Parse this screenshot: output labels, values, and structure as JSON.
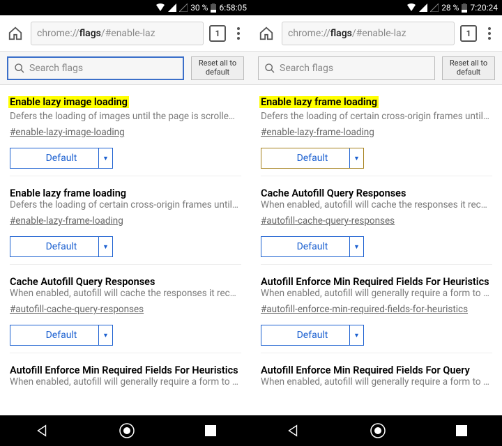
{
  "left": {
    "status": {
      "battery_pct": "30 %",
      "time": "6:58:05"
    },
    "omnibox": {
      "prefix": "chrome://",
      "bold": "flags",
      "suffix": "/#enable-laz"
    },
    "tab_count": "1",
    "search_placeholder": "Search flags",
    "reset_label": "Reset all to default",
    "flags": [
      {
        "title": "Enable lazy image loading",
        "desc": "Defers the loading of images until the page is scrolle…",
        "anchor": "#enable-lazy-image-loading",
        "select": "Default",
        "highlight": true,
        "gold": false
      },
      {
        "title": "Enable lazy frame loading",
        "desc": "Defers the loading of certain cross-origin frames until…",
        "anchor": "#enable-lazy-frame-loading",
        "select": "Default",
        "highlight": false,
        "gold": false
      },
      {
        "title": "Cache Autofill Query Responses",
        "desc": "When enabled, autofill will cache the responses it rec…",
        "anchor": "#autofill-cache-query-responses",
        "select": "Default",
        "highlight": false,
        "gold": false
      },
      {
        "title": "Autofill Enforce Min Required Fields For Heuristics",
        "desc": "When enabled, autofill will generally require a form to …",
        "anchor": "",
        "select": "",
        "highlight": false,
        "gold": false
      }
    ]
  },
  "right": {
    "status": {
      "battery_pct": "28 %",
      "time": "7:20:24"
    },
    "omnibox": {
      "prefix": "chrome://",
      "bold": "flags",
      "suffix": "/#enable-laz"
    },
    "tab_count": "1",
    "search_placeholder": "Search flags",
    "reset_label": "Reset all to default",
    "flags": [
      {
        "title": "Enable lazy frame loading",
        "desc": "Defers the loading of certain cross-origin frames until…",
        "anchor": "#enable-lazy-frame-loading",
        "select": "Default",
        "highlight": true,
        "gold": true
      },
      {
        "title": "Cache Autofill Query Responses",
        "desc": "When enabled, autofill will cache the responses it rec…",
        "anchor": "#autofill-cache-query-responses",
        "select": "Default",
        "highlight": false,
        "gold": false
      },
      {
        "title": "Autofill Enforce Min Required Fields For Heuristics",
        "desc": "When enabled, autofill will generally require a form to …",
        "anchor": "#autofill-enforce-min-required-fields-for-heuristics",
        "select": "Default",
        "highlight": false,
        "gold": false
      },
      {
        "title": "Autofill Enforce Min Required Fields For Query",
        "desc": "When enabled, autofill will generally require a form to …",
        "anchor": "",
        "select": "",
        "highlight": false,
        "gold": false
      }
    ]
  }
}
